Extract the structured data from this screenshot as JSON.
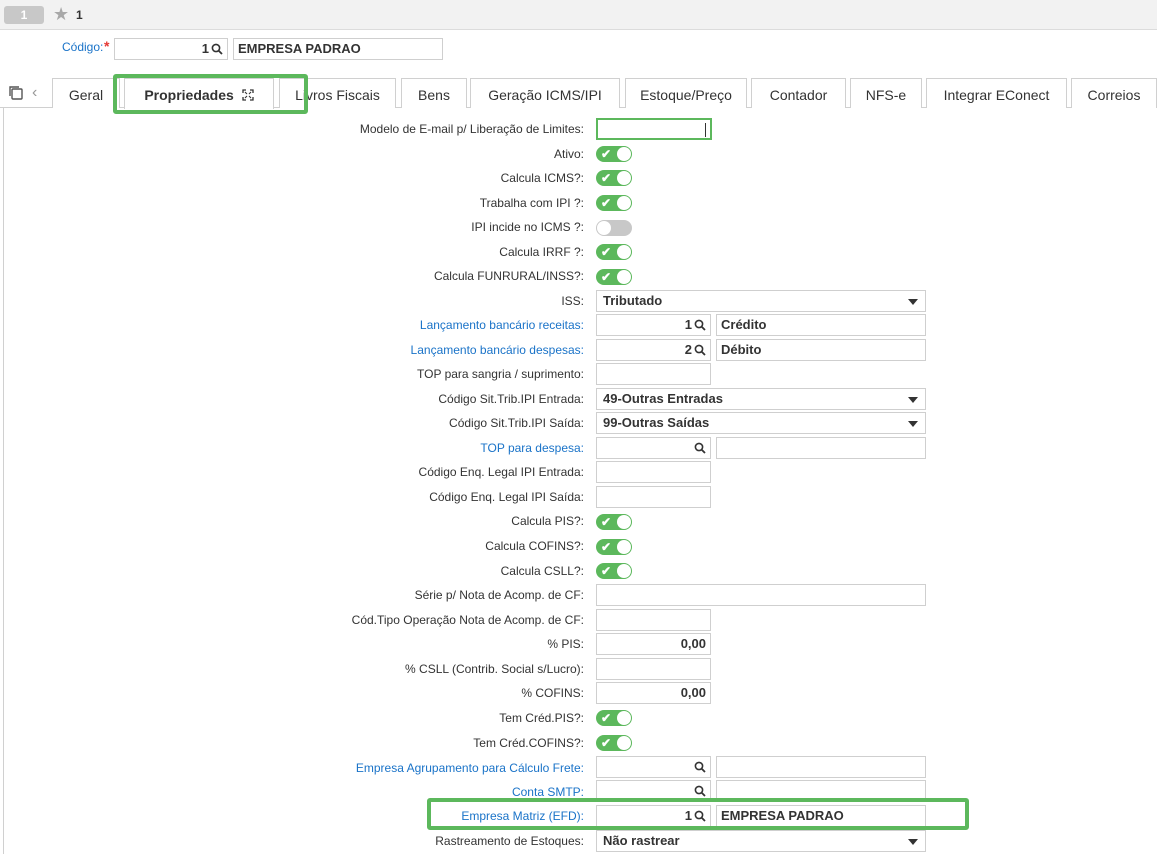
{
  "header": {
    "record_number": "1",
    "favorite_count": "1"
  },
  "codigo": {
    "label": "Código:",
    "required_mark": "*",
    "value": "1",
    "name": "EMPRESA PADRAO"
  },
  "tabs": [
    {
      "label": "Geral"
    },
    {
      "label": "Propriedades"
    },
    {
      "label": "Livros Fiscais"
    },
    {
      "label": "Bens"
    },
    {
      "label": "Geração ICMS/IPI"
    },
    {
      "label": "Estoque/Preço"
    },
    {
      "label": "Contador"
    },
    {
      "label": "NFS-e"
    },
    {
      "label": "Integrar EConect"
    },
    {
      "label": "Correios"
    }
  ],
  "form": {
    "modelo_email": {
      "label": "Modelo de E-mail p/ Liberação de Limites:",
      "value": ""
    },
    "ativo": {
      "label": "Ativo:",
      "checked": true
    },
    "calcula_icms": {
      "label": "Calcula ICMS?:",
      "checked": true
    },
    "trabalha_ipi": {
      "label": "Trabalha com IPI ?:",
      "checked": true
    },
    "ipi_incide_icms": {
      "label": "IPI incide no ICMS ?:",
      "checked": false
    },
    "calcula_irrf": {
      "label": "Calcula IRRF ?:",
      "checked": true
    },
    "calcula_funrural": {
      "label": "Calcula FUNRURAL/INSS?:",
      "checked": true
    },
    "iss": {
      "label": "ISS:",
      "value": "Tributado"
    },
    "lanc_receitas": {
      "label": "Lançamento bancário receitas:",
      "code": "1",
      "desc": "Crédito"
    },
    "lanc_despesas": {
      "label": "Lançamento bancário despesas:",
      "code": "2",
      "desc": "Débito"
    },
    "top_sangria": {
      "label": "TOP para sangria / suprimento:",
      "value": ""
    },
    "sit_trib_entrada": {
      "label": "Código Sit.Trib.IPI Entrada:",
      "value": "49-Outras Entradas"
    },
    "sit_trib_saida": {
      "label": "Código Sit.Trib.IPI Saída:",
      "value": "99-Outras Saídas"
    },
    "top_despesa": {
      "label": "TOP para despesa:",
      "code": "",
      "desc": ""
    },
    "enq_entrada": {
      "label": "Código Enq. Legal IPI Entrada:",
      "value": ""
    },
    "enq_saida": {
      "label": "Código Enq. Legal IPI Saída:",
      "value": ""
    },
    "calcula_pis": {
      "label": "Calcula PIS?:",
      "checked": true
    },
    "calcula_cofins": {
      "label": "Calcula COFINS?:",
      "checked": true
    },
    "calcula_csll": {
      "label": "Calcula CSLL?:",
      "checked": true
    },
    "serie_nota": {
      "label": "Série p/ Nota de Acomp. de CF:",
      "value": ""
    },
    "cod_tipo_op": {
      "label": "Cód.Tipo Operação Nota de Acomp. de CF:",
      "value": ""
    },
    "pct_pis": {
      "label": "% PIS:",
      "value": "0,00"
    },
    "pct_csll": {
      "label": "% CSLL (Contrib. Social s/Lucro):",
      "value": ""
    },
    "pct_cofins": {
      "label": "% COFINS:",
      "value": "0,00"
    },
    "tem_cred_pis": {
      "label": "Tem Créd.PIS?:",
      "checked": true
    },
    "tem_cred_cofins": {
      "label": "Tem Créd.COFINS?:",
      "checked": true
    },
    "empresa_agrup": {
      "label": "Empresa Agrupamento para Cálculo Frete:",
      "code": "",
      "desc": ""
    },
    "conta_smtp": {
      "label": "Conta SMTP:",
      "code": "",
      "desc": ""
    },
    "empresa_matriz": {
      "label": "Empresa Matriz (EFD):",
      "code": "1",
      "desc": "EMPRESA PADRAO"
    },
    "rastreamento": {
      "label": "Rastreamento de Estoques:",
      "value": "Não rastrear"
    }
  },
  "colors": {
    "accent_green": "#5cb85c",
    "link_blue": "#1a73c8",
    "required_red": "#e53935"
  }
}
